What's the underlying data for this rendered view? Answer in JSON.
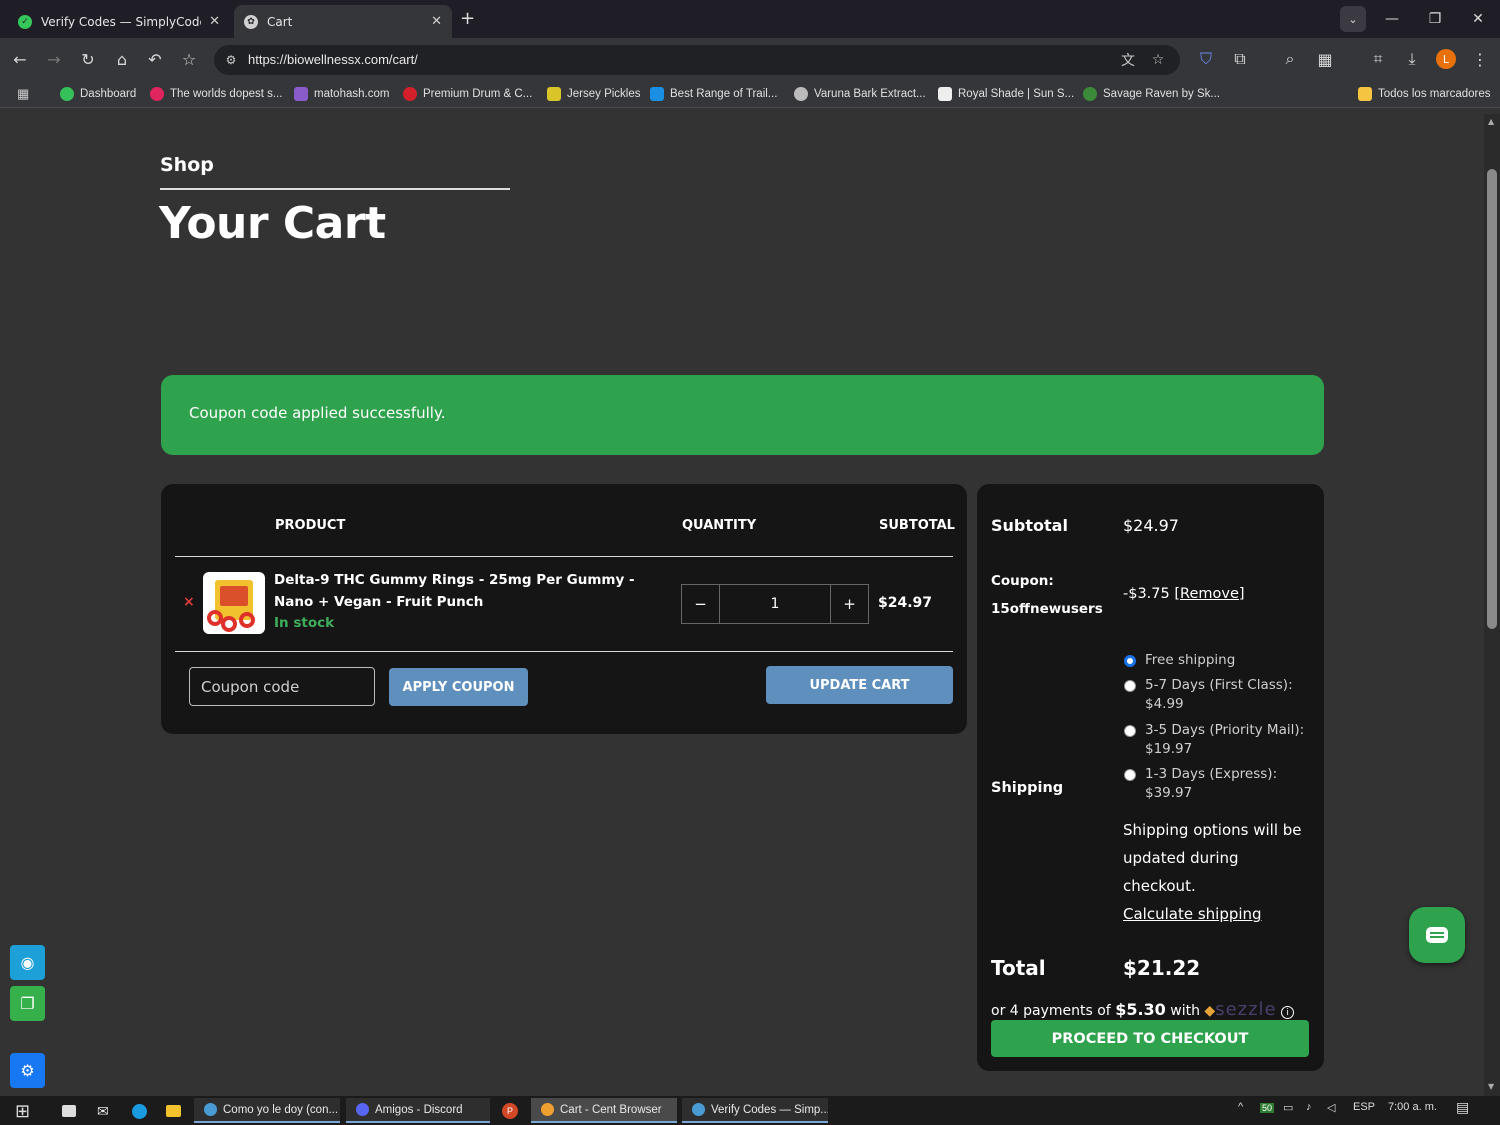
{
  "browser": {
    "tabs": [
      {
        "label": "Verify Codes — SimplyCodes",
        "icon": "simplycodes-icon",
        "active": false
      },
      {
        "label": "Cart",
        "icon": "site-icon",
        "active": true
      }
    ],
    "url": "https://biowellnessx.com/cart/",
    "avatar_letter": "L",
    "bookmarks": [
      "Dashboard",
      "The worlds dopest s...",
      "matohash.com",
      "Premium Drum & C...",
      "Jersey Pickles",
      "Best Range of Trail...",
      "Varuna Bark Extract...",
      "Royal Shade | Sun S...",
      "Savage Raven by Sk..."
    ],
    "bookmarks_folder": "Todos los marcadores"
  },
  "page": {
    "breadcrumb": "Shop",
    "title": "Your Cart",
    "notice": "Coupon code applied successfully.",
    "table": {
      "headers": {
        "product": "PRODUCT",
        "quantity": "QUANTITY",
        "subtotal": "SUBTOTAL"
      },
      "item": {
        "remove": "×",
        "name": "Delta-9 THC Gummy Rings - 25mg Per Gummy - Nano + Vegan - Fruit Punch",
        "stock": "In stock",
        "minus": "−",
        "quantity": "1",
        "plus": "+",
        "subtotal": "$24.97"
      },
      "coupon_placeholder": "Coupon code",
      "apply_coupon": "APPLY COUPON",
      "update_cart": "UPDATE CART"
    },
    "totals": {
      "subtotal_label": "Subtotal",
      "subtotal_value": "$24.97",
      "coupon_label": "Coupon:",
      "coupon_code": "15offnewusers",
      "coupon_value": "-$3.75",
      "coupon_remove": "[Remove]",
      "shipping_label": "Shipping",
      "shipping_options": [
        {
          "label": "Free shipping",
          "selected": true
        },
        {
          "label": "5-7 Days (First Class): $4.99",
          "selected": false
        },
        {
          "label": "3-5 Days (Priority Mail): $19.97",
          "selected": false
        },
        {
          "label": "1-3 Days (Express): $39.97",
          "selected": false
        }
      ],
      "shipping_note": "Shipping options will be updated during checkout.",
      "calculate_shipping": "Calculate shipping",
      "total_label": "Total",
      "total_value": "$21.22",
      "sezzle_prefix": "or 4 payments of",
      "sezzle_amount": "$5.30",
      "sezzle_with": "with",
      "sezzle_brand": "sezzle",
      "checkout": "PROCEED TO CHECKOUT"
    }
  },
  "taskbar": {
    "windows": [
      {
        "label": "Como yo le doy (con...",
        "active": false
      },
      {
        "label": "Amigos - Discord",
        "active": false
      },
      {
        "label": "Cart - Cent Browser",
        "active": true
      },
      {
        "label": "Verify Codes — Simp...",
        "active": false
      }
    ],
    "tray": {
      "battery": "50",
      "language": "ESP",
      "time": "7:00 a. m."
    }
  },
  "colors": {
    "success_green": "#2fa24d",
    "button_blue": "#5e8fbd",
    "remove_red": "#e03b3b",
    "stock_green": "#3fae5c",
    "panel_bg": "#151515",
    "page_bg": "#333333"
  }
}
